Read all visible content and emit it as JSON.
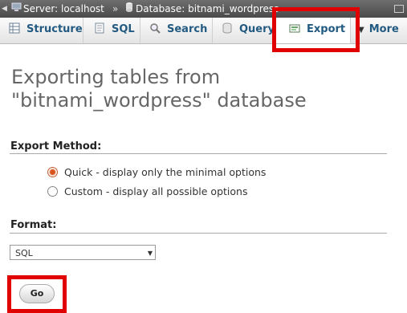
{
  "breadcrumb": {
    "server": "Server: localhost",
    "separator": "»",
    "database": "Database: bitnami_wordpress"
  },
  "tabs": [
    {
      "label": "Structure",
      "icon": "structure-icon"
    },
    {
      "label": "SQL",
      "icon": "sql-icon"
    },
    {
      "label": "Search",
      "icon": "search-icon"
    },
    {
      "label": "Query",
      "icon": "query-icon"
    },
    {
      "label": "Export",
      "icon": "export-icon",
      "active": true
    },
    {
      "label": "More",
      "icon": "chevron-down-icon"
    }
  ],
  "page": {
    "title_line1": "Exporting tables from",
    "title_line2": "\"bitnami_wordpress\" database"
  },
  "export_method": {
    "title": "Export Method:",
    "options": [
      {
        "label": "Quick - display only the minimal options",
        "checked": true
      },
      {
        "label": "Custom - display all possible options",
        "checked": false
      }
    ]
  },
  "format": {
    "title": "Format:",
    "selected": "SQL"
  },
  "go_label": "Go",
  "colors": {
    "highlight": "#e00000",
    "tab_text": "#235a81"
  }
}
